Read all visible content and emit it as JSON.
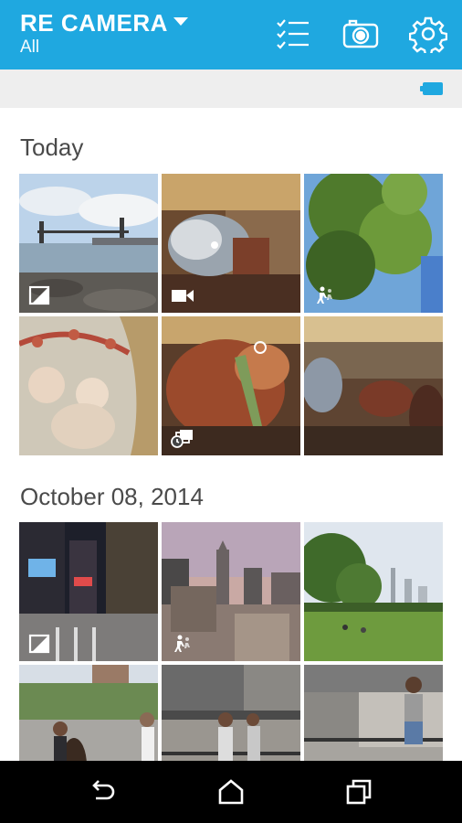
{
  "app": {
    "title": "RE CAMERA",
    "filter": "All"
  },
  "toolbar": {
    "select_icon": "checklist-icon",
    "camera_icon": "camera-icon",
    "settings_icon": "gear-icon"
  },
  "status": {
    "battery_icon": "battery-icon",
    "accent": "#1fa8e0"
  },
  "sections": [
    {
      "date": "Today",
      "items": [
        {
          "subject": "bridge over river",
          "badge": "exposure-icon"
        },
        {
          "subject": "carousel horse",
          "badge": "video-icon"
        },
        {
          "subject": "tree and sky",
          "badge": "hyperlapse-icon"
        },
        {
          "subject": "painted cherubs",
          "badge": ""
        },
        {
          "subject": "carousel horse closeup",
          "badge": "burst-timer-icon"
        },
        {
          "subject": "carousel horses",
          "badge": ""
        }
      ]
    },
    {
      "date": "October 08, 2014",
      "items": [
        {
          "subject": "city street at night",
          "badge": "exposure-icon"
        },
        {
          "subject": "city skyline",
          "badge": "hyperlapse-icon"
        },
        {
          "subject": "park lawn",
          "badge": ""
        },
        {
          "subject": "street musician",
          "badge": ""
        },
        {
          "subject": "people under overpass",
          "badge": ""
        },
        {
          "subject": "person dancing",
          "badge": ""
        }
      ]
    }
  ],
  "nav": {
    "back_icon": "back-icon",
    "home_icon": "home-icon",
    "recents_icon": "recents-icon"
  }
}
